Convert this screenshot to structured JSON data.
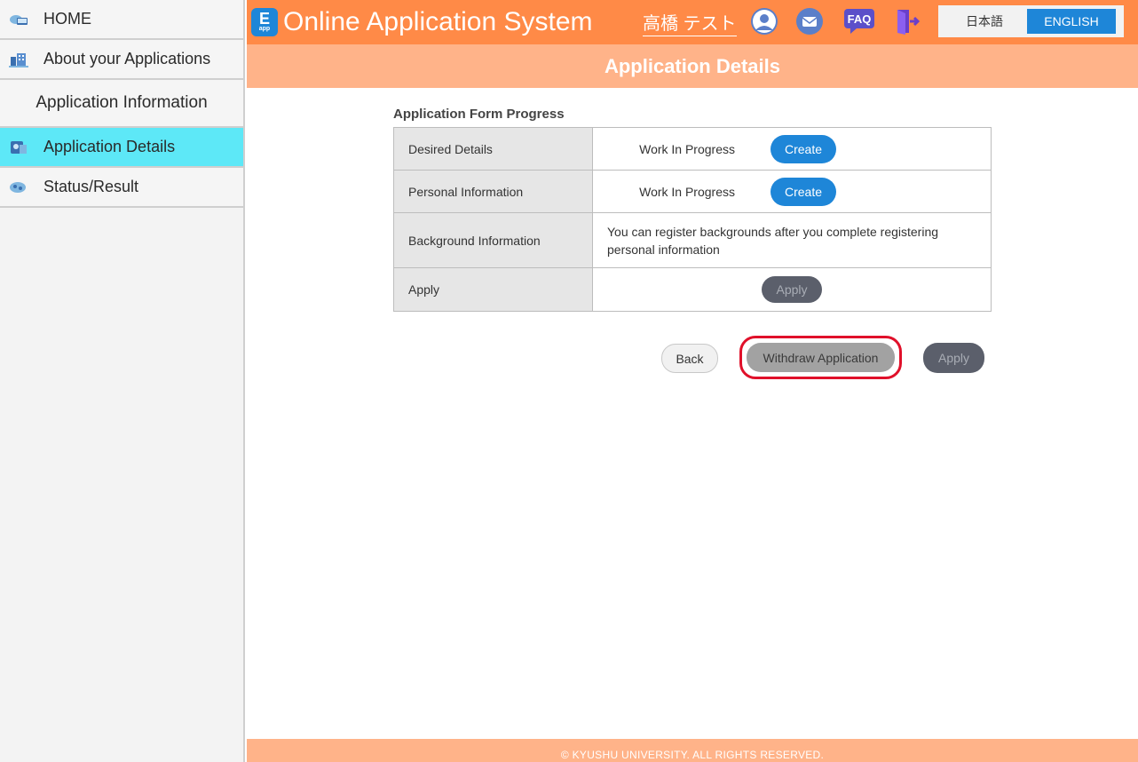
{
  "sidebar": {
    "items": [
      {
        "label": "HOME",
        "icon": "home-icon"
      },
      {
        "label": "About your Applications",
        "icon": "building-icon"
      }
    ],
    "section_title": "Application Information",
    "sub_items": [
      {
        "label": "Application Details",
        "icon": "details-icon",
        "active": true
      },
      {
        "label": "Status/Result",
        "icon": "status-icon",
        "active": false
      }
    ]
  },
  "header": {
    "logo_letter": "E",
    "logo_sub": "app",
    "app_title": "Online Application System",
    "user_name": "高橋 テスト",
    "faq_label": "FAQ",
    "lang_ja": "日本語",
    "lang_en": "ENGLISH",
    "colors": {
      "header_bg": "#ff8a47",
      "title_bar_bg": "#ffb389",
      "accent_blue": "#1e86d8"
    }
  },
  "page": {
    "title": "Application Details",
    "section_label": "Application Form  Progress"
  },
  "progress_table": {
    "rows": [
      {
        "label": "Desired Details",
        "status": "Work In Progress",
        "button": "Create"
      },
      {
        "label": "Personal Information",
        "status": "Work In Progress",
        "button": "Create"
      },
      {
        "label": "Background Information",
        "note": "You can register backgrounds after you complete registering personal information"
      },
      {
        "label": "Apply",
        "button": "Apply"
      }
    ]
  },
  "actions": {
    "back": "Back",
    "withdraw": "Withdraw Application",
    "apply": "Apply"
  },
  "footer": {
    "copyright": "© KYUSHU UNIVERSITY. ALL RIGHTS RESERVED."
  }
}
